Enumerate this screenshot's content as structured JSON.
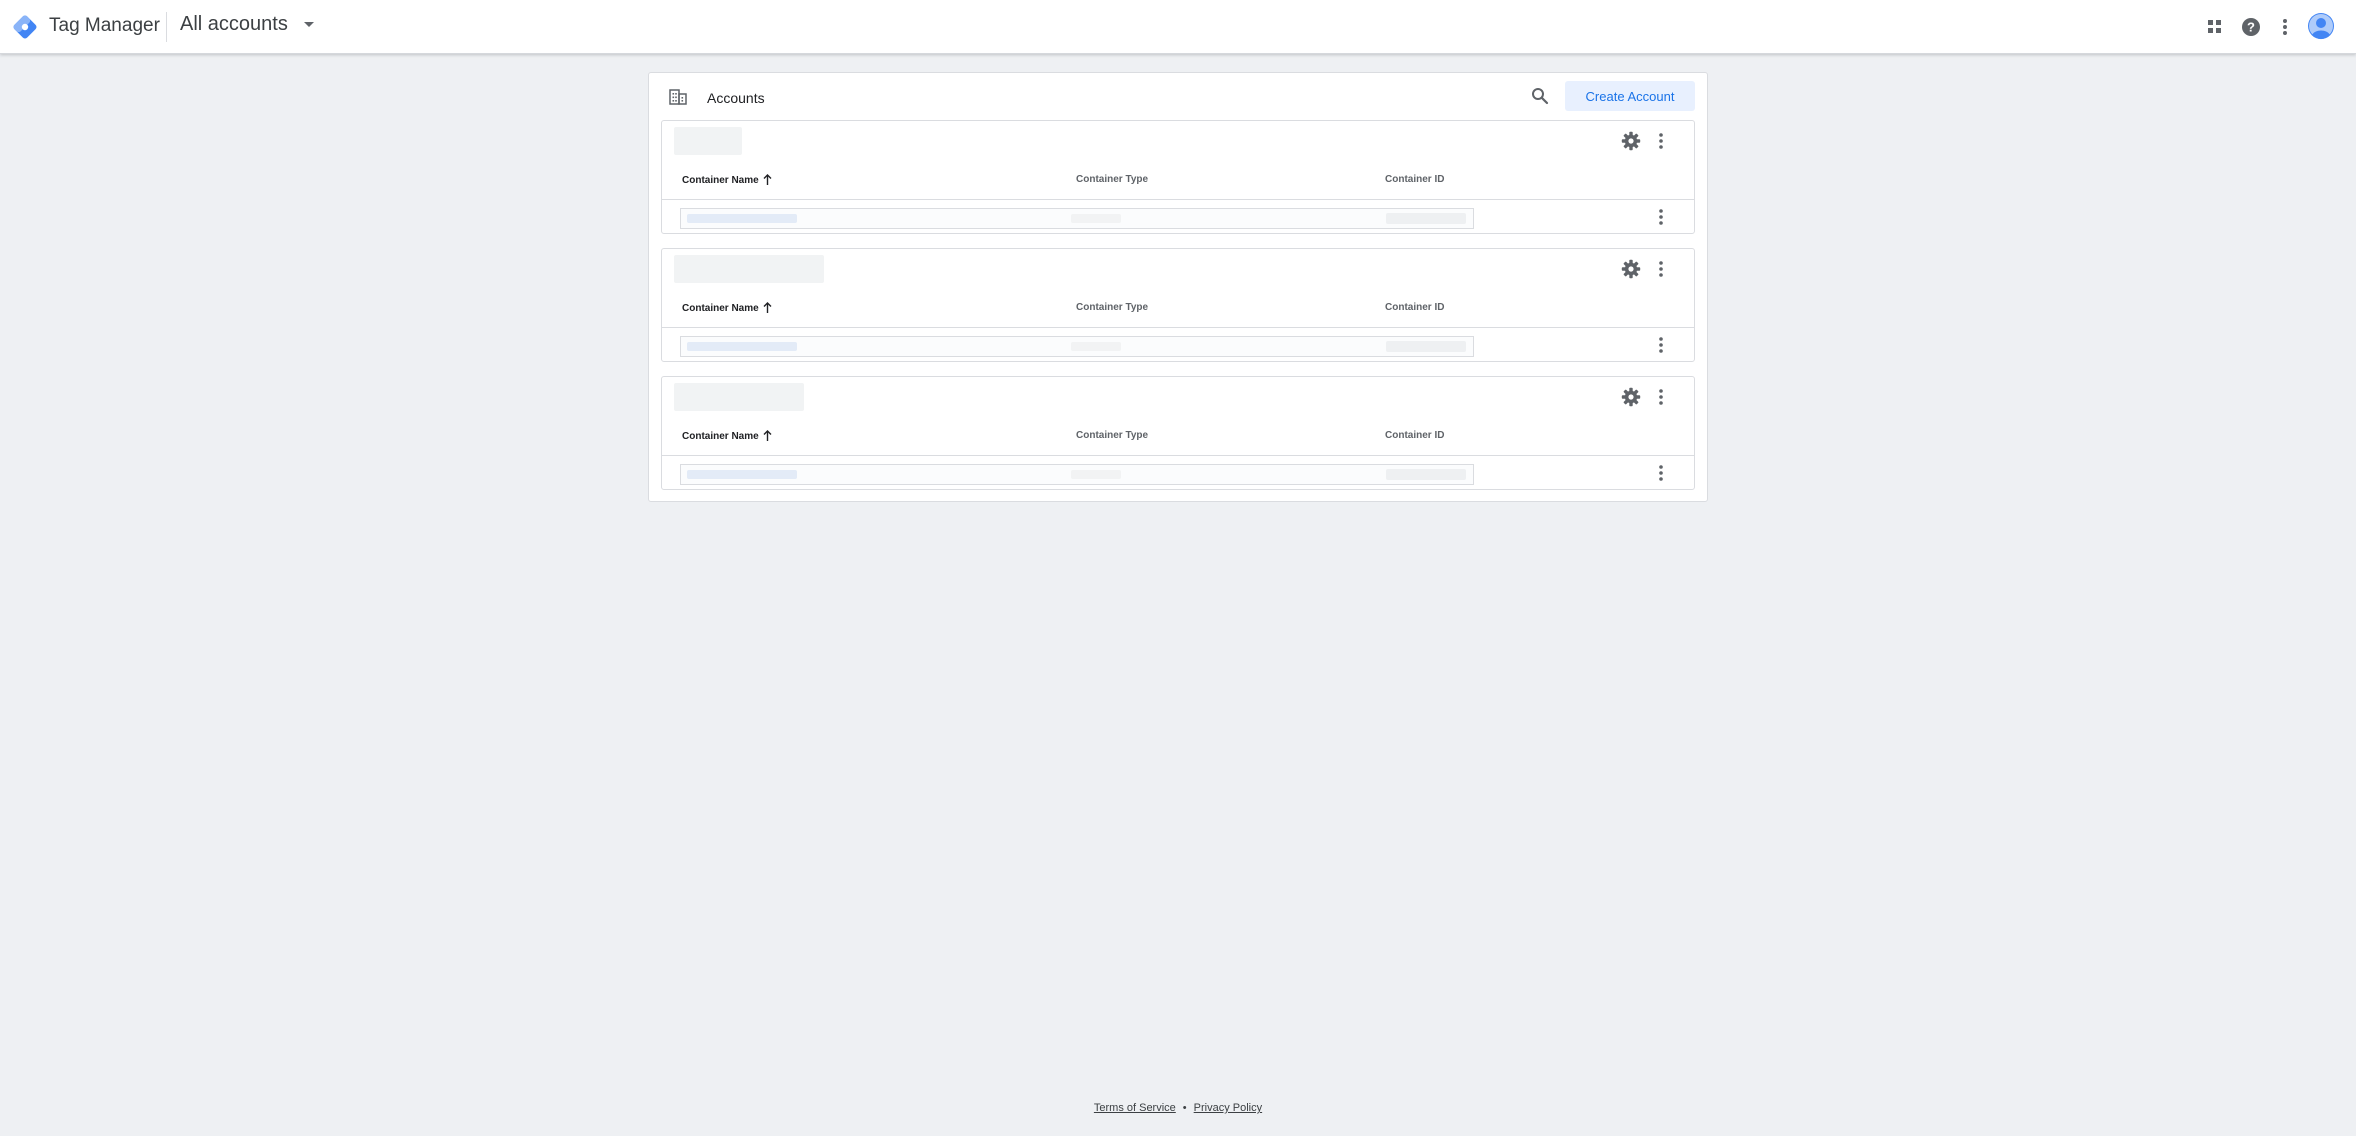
{
  "header": {
    "app_title": "Tag Manager",
    "account_switcher": "All accounts",
    "icons": [
      "apps-grid-icon",
      "help-icon",
      "more-vert-icon",
      "account-avatar-icon"
    ]
  },
  "accounts_card": {
    "title": "Accounts",
    "create_button": "Create Account",
    "columns": {
      "name": "Container Name",
      "type": "Container Type",
      "id": "Container ID"
    },
    "accounts": [
      {
        "name_redacted": true,
        "sort": "ascending"
      },
      {
        "name_redacted": true,
        "sort": "ascending"
      },
      {
        "name_redacted": true,
        "sort": "ascending"
      }
    ]
  },
  "footer": {
    "terms": "Terms of Service",
    "separator": "•",
    "privacy": "Privacy Policy"
  },
  "colors": {
    "brand_blue": "#1a73e8",
    "background": "#eef0f3",
    "button_bg": "#e8f0fe"
  }
}
